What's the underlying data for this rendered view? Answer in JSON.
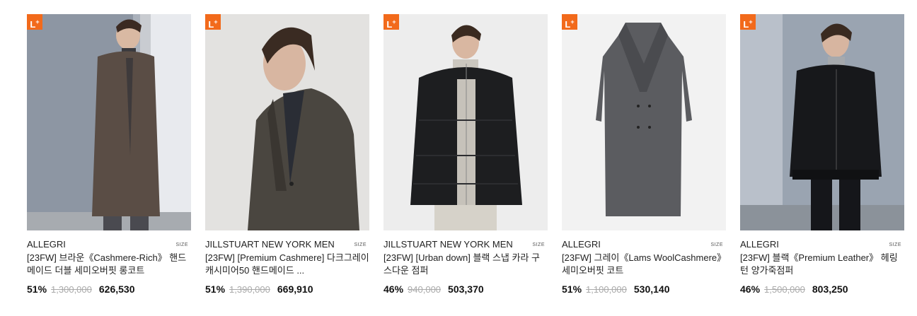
{
  "products": [
    {
      "badge": "L",
      "size_label": "SIZE",
      "brand": "ALLEGRI",
      "title": "[23FW] 브라운《Cashmere-Rich》 핸드메이드 더블 세미오버핏 롱코트",
      "discount": "51%",
      "original_price": "1,300,000",
      "price": "626,530",
      "image": "model-brown-longcoat"
    },
    {
      "badge": "L",
      "size_label": "SIZE",
      "brand": "JILLSTUART NEW YORK MEN",
      "title": "[23FW] [Premium Cashmere] 다크그레이 캐시미어50 핸드메이드 ...",
      "discount": "51%",
      "original_price": "1,390,000",
      "price": "669,910",
      "image": "model-darkgrey-coat"
    },
    {
      "badge": "L",
      "size_label": "SIZE",
      "brand": "JILLSTUART NEW YORK MEN",
      "title": "[23FW] [Urban down] 블랙 스냅 카라 구스다운 점퍼",
      "discount": "46%",
      "original_price": "940,000",
      "price": "503,370",
      "image": "model-black-down-jacket"
    },
    {
      "badge": "L",
      "size_label": "SIZE",
      "brand": "ALLEGRI",
      "title": "[23FW] 그레이《Lams WoolCashmere》세미오버핏 코트",
      "discount": "51%",
      "original_price": "1,100,000",
      "price": "530,140",
      "image": "grey-coat-product"
    },
    {
      "badge": "L",
      "size_label": "SIZE",
      "brand": "ALLEGRI",
      "title": "[23FW] 블랙《Premium Leather》 헤링턴 양가죽점퍼",
      "discount": "46%",
      "original_price": "1,500,000",
      "price": "803,250",
      "image": "model-black-leather-jacket"
    }
  ],
  "colors": {
    "badge": "#f26a1b",
    "strike": "#aaaaaa",
    "text": "#222222"
  }
}
